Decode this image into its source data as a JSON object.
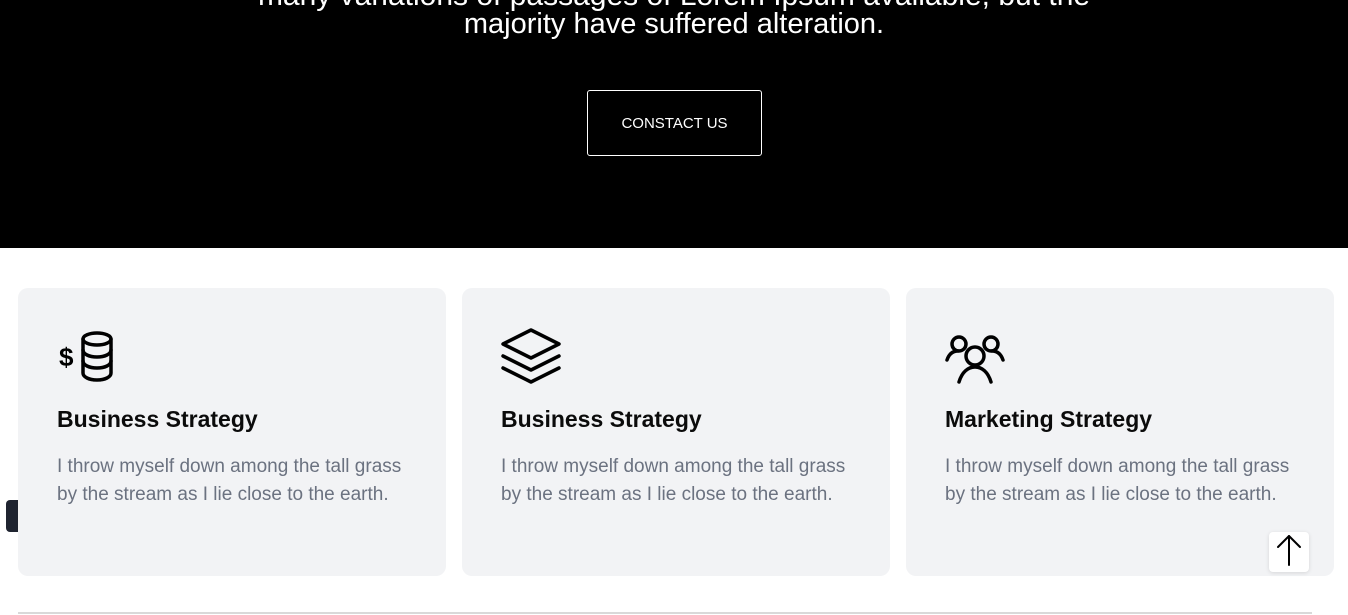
{
  "hero": {
    "clipped_line": "many variations of passages of Lorem Ipsum available, but the",
    "text": "majority have suffered alteration.",
    "button_label": "CONSTACT US"
  },
  "cards": [
    {
      "icon": "coins-dollar-icon",
      "title": "Business Strategy",
      "description": "I throw myself down among the tall grass by the stream as I lie close to the earth."
    },
    {
      "icon": "layers-icon",
      "title": "Business Strategy",
      "description": "I throw myself down among the tall grass by the stream as I lie close to the earth."
    },
    {
      "icon": "users-group-icon",
      "title": "Marketing Strategy",
      "description": "I throw myself down among the tall grass by the stream as I lie close to the earth."
    }
  ],
  "scroll_top": {
    "icon": "arrow-up-icon"
  },
  "colors": {
    "hero_background": "#000000",
    "card_background": "#f2f3f5",
    "card_text": "#6b7280"
  }
}
